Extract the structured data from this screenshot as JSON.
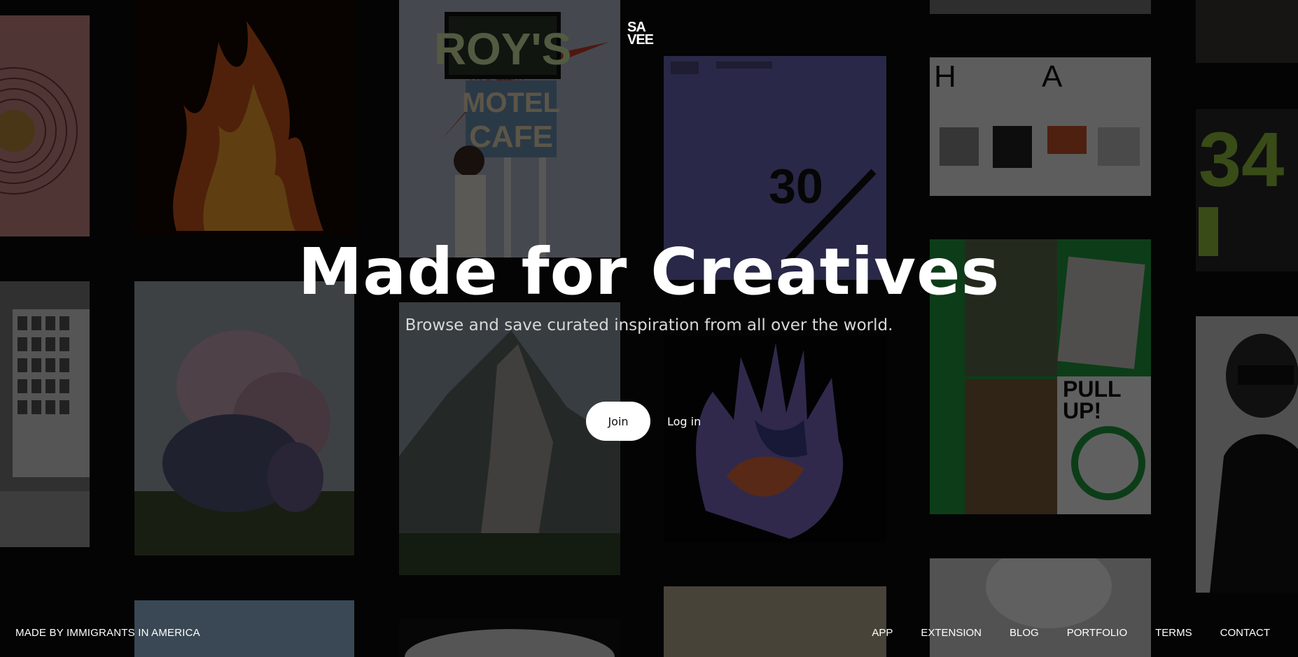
{
  "logo": {
    "line1": "SA",
    "line2": "VEE"
  },
  "hero": {
    "title": "Made for Creatives",
    "subtitle": "Browse and save curated inspiration from all over the world."
  },
  "actions": {
    "join_label": "Join",
    "login_label": "Log in"
  },
  "footer": {
    "tagline": "MADE BY IMMIGRANTS IN AMERICA",
    "links": [
      "APP",
      "EXTENSION",
      "BLOG",
      "PORTFOLIO",
      "TERMS",
      "CONTACT"
    ]
  },
  "tiles": {
    "roys_sign": "ROY'S",
    "vacancy_sign": "VACANCY",
    "motel_sign": "MOTEL",
    "cafe_sign": "CAFE",
    "poster_number": "30",
    "poster_h": "H",
    "poster_a": "A",
    "jersey_big": "34",
    "pullup_text_1": "PULL",
    "pullup_text_2": "UP!"
  }
}
